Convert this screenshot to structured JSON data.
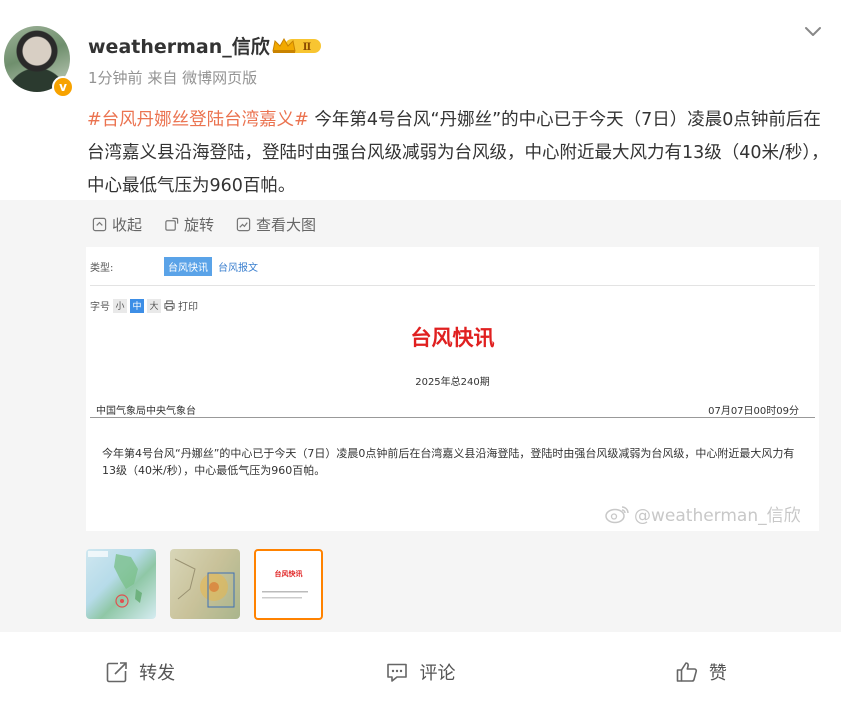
{
  "post": {
    "username": "weatherman_信欣",
    "vip_level": "Ⅱ",
    "avatar_badge": "v",
    "time": "1分钟前",
    "source": "来自 微博网页版",
    "hashtag": "#台风丹娜丝登陆台湾嘉义#",
    "text": " 今年第4号台风“丹娜丝”的中心已于今天（7日）凌晨0点钟前后在台湾嘉义县沿海登陆，登陆时由强台风级减弱为台风级，中心附近最大风力有13级（40米/秒），中心最低气压为960百帕。"
  },
  "media_tools": {
    "collapse": "收起",
    "rotate": "旋转",
    "view_large": "查看大图"
  },
  "doc": {
    "type_label": "类型:",
    "tag_active": "台风快讯",
    "tag_other": "台风报文",
    "fontsize_label": "字号",
    "fs_small": "小",
    "fs_medium": "中",
    "fs_large": "大",
    "print": "打印",
    "title": "台风快讯",
    "issue": "2025年总240期",
    "org": "中国气象局中央气象台",
    "time": "07月07日00时09分",
    "body": "今年第4号台风“丹娜丝”的中心已于今天（7日）凌晨0点钟前后在台湾嘉义县沿海登陆，登陆时由强台风级减弱为台风级，中心附近最大风力有13级（40米/秒），中心最低气压为960百帕。",
    "watermark": "@weatherman_信欣"
  },
  "thumbnails": {
    "thumb3_title": "台风快讯"
  },
  "actions": {
    "repost": "转发",
    "comment": "评论",
    "like": "赞"
  },
  "colors": {
    "hashtag": "#eb7350",
    "doc_title": "#e02020",
    "selected_thumb_border": "#ff8200"
  }
}
